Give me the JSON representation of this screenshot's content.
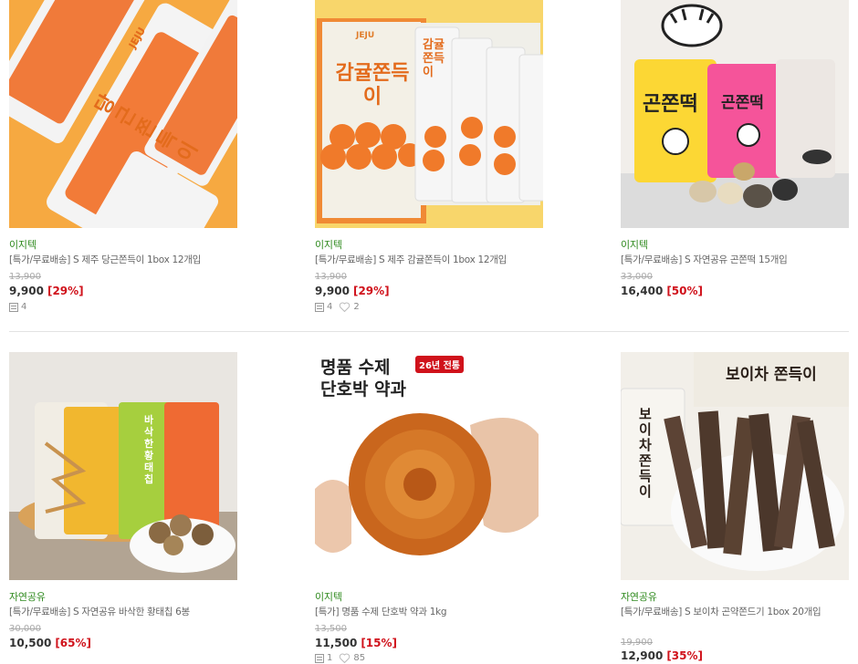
{
  "products": [
    {
      "brand": "이지텍",
      "title": "[특가/무료배송] S 제주 당근쫀득이 1box 12개입",
      "original_price": "13,900",
      "price": "9,900",
      "discount": "[29%]",
      "reviews": "4",
      "likes": ""
    },
    {
      "brand": "이지텍",
      "title": "[특가/무료배송] S 제주 감귤쫀득이 1box 12개입",
      "original_price": "13,900",
      "price": "9,900",
      "discount": "[29%]",
      "reviews": "4",
      "likes": "2"
    },
    {
      "brand": "이지텍",
      "title": "[특가/무료배송] S 자연공유 곤쫀떡 15개입",
      "original_price": "33,000",
      "price": "16,400",
      "discount": "[50%]",
      "reviews": "",
      "likes": ""
    },
    {
      "brand": "자연공유",
      "title": "[특가/무료배송] S 자연공유 바삭한 황태칩 6봉",
      "original_price": "30,000",
      "price": "10,500",
      "discount": "[65%]",
      "reviews": "",
      "likes": ""
    },
    {
      "brand": "이지텍",
      "title": "[특가] 명품 수제 단호박 약과 1kg",
      "original_price": "13,500",
      "price": "11,500",
      "discount": "[15%]",
      "reviews": "1",
      "likes": "85"
    },
    {
      "brand": "자연공유",
      "title": "[특가/무료배송] S 보이차 곤약쫀드기 1box 20개입",
      "original_price": "19,900",
      "price": "12,900",
      "discount": "[35%]",
      "reviews": "",
      "likes": ""
    }
  ],
  "image_text": {
    "p1": {
      "jeju": "JEJU",
      "name": "당근쫀득이"
    },
    "p2": {
      "jeju": "JEJU",
      "name": "감귤쫀득이",
      "pack": "감귤쫀득이"
    },
    "p3": {
      "name": "곤쫀떡",
      "pink": "곤쫀떡"
    },
    "p4": {
      "bag": "바삭한 황태칩"
    },
    "p5": {
      "headline1": "명품 수제",
      "headline2": "단호박 약과",
      "badge": "26년 전통"
    },
    "p6": {
      "box": "보이차 쫀득이",
      "pack": "보이차 쫀득이"
    }
  },
  "colors": {
    "brand": "#2f8a1e",
    "discount": "#d0121b",
    "divider": "#e3e3e3"
  }
}
